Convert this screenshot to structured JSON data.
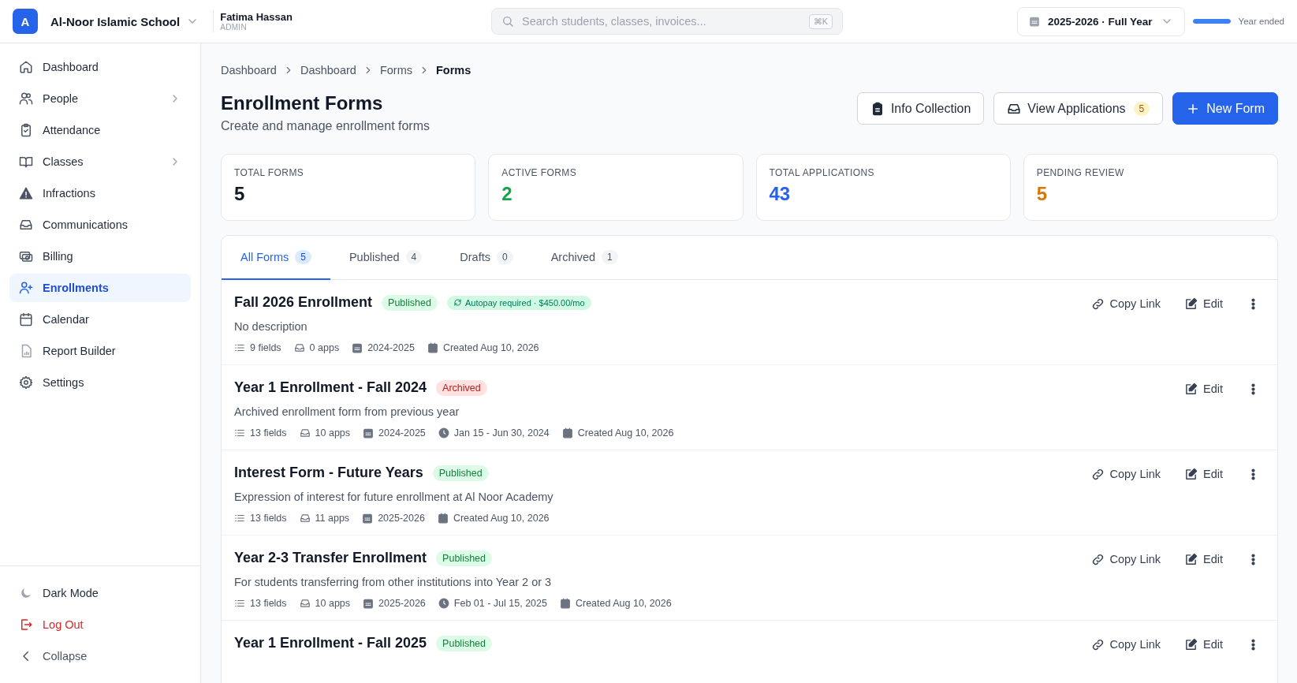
{
  "app": {
    "logo_letter": "A",
    "school": "Al-Noor Islamic School",
    "user_name": "Fatima Hassan",
    "user_role": "ADMIN"
  },
  "search": {
    "placeholder": "Search students, classes, invoices...",
    "shortcut": "⌘K"
  },
  "year_selector": {
    "label": "2025-2026 · Full Year"
  },
  "year_progress": {
    "level": 1,
    "label": "Year ended"
  },
  "sidebar": {
    "items": [
      {
        "label": "Dashboard",
        "kind": "home",
        "has_submenu": false,
        "selected": false
      },
      {
        "label": "People",
        "kind": "people",
        "has_submenu": true,
        "selected": false
      },
      {
        "label": "Attendance",
        "kind": "clipboard",
        "has_submenu": false,
        "selected": false
      },
      {
        "label": "Classes",
        "kind": "book",
        "has_submenu": true,
        "selected": false
      },
      {
        "label": "Infractions",
        "kind": "warning",
        "has_submenu": false,
        "selected": false
      },
      {
        "label": "Communications",
        "kind": "inbox",
        "has_submenu": false,
        "selected": false
      },
      {
        "label": "Billing",
        "kind": "money",
        "has_submenu": false,
        "selected": false
      },
      {
        "label": "Enrollments",
        "kind": "userplus",
        "has_submenu": false,
        "selected": true
      },
      {
        "label": "Calendar",
        "kind": "calendar",
        "has_submenu": false,
        "selected": false
      },
      {
        "label": "Report Builder",
        "kind": "report",
        "has_submenu": false,
        "selected": false
      },
      {
        "label": "Settings",
        "kind": "gear",
        "has_submenu": false,
        "selected": false
      }
    ],
    "footer": [
      {
        "label": "Dark Mode",
        "kind": "theme"
      },
      {
        "label": "Log Out",
        "kind": "logout"
      },
      {
        "label": "Collapse",
        "kind": "collapse"
      }
    ]
  },
  "breadcrumb": [
    "Dashboard",
    "Dashboard",
    "Forms",
    "Forms"
  ],
  "page": {
    "title": "Enrollment Forms",
    "subtitle": "Create and manage enrollment forms"
  },
  "actions": [
    {
      "kind": "info",
      "label": "Info Collection"
    },
    {
      "kind": "applications",
      "label": "View Applications",
      "badge": "5"
    },
    {
      "kind": "new",
      "label": "New Form"
    }
  ],
  "stats": [
    {
      "label": "TOTAL FORMS",
      "value": "5",
      "color": "#111827"
    },
    {
      "label": "ACTIVE FORMS",
      "value": "2",
      "color": "#16a34a"
    },
    {
      "label": "TOTAL APPLICATIONS",
      "value": "43",
      "color": "#2563eb"
    },
    {
      "label": "PENDING REVIEW",
      "value": "5",
      "color": "#d97706"
    }
  ],
  "tabs": [
    {
      "label": "All Forms",
      "count": "5",
      "selected": true
    },
    {
      "label": "Published",
      "count": "4",
      "selected": false
    },
    {
      "label": "Drafts",
      "count": "0",
      "selected": false
    },
    {
      "label": "Archived",
      "count": "1",
      "selected": false
    }
  ],
  "forms": [
    {
      "title": "Fall 2026 Enrollment",
      "status": {
        "kind": "published",
        "label": "Published"
      },
      "autopay": "Autopay required · $450.00/mo",
      "description": "No description",
      "meta": [
        {
          "kind": "fields",
          "text": "9 fields"
        },
        {
          "kind": "apps",
          "text": "0 apps"
        },
        {
          "kind": "year",
          "text": "2024-2025"
        },
        {
          "kind": "created",
          "text": "Created Aug 10, 2026"
        }
      ],
      "copy_link": "Copy Link",
      "edit": "Edit"
    },
    {
      "title": "Year 1 Enrollment - Fall 2024",
      "status": {
        "kind": "archived",
        "label": "Archived"
      },
      "description": "Archived enrollment form from previous year",
      "meta": [
        {
          "kind": "fields",
          "text": "13 fields"
        },
        {
          "kind": "apps",
          "text": "10 apps"
        },
        {
          "kind": "year",
          "text": "2024-2025"
        },
        {
          "kind": "window",
          "text": "Jan 15 - Jun 30, 2024"
        },
        {
          "kind": "created",
          "text": "Created Aug 10, 2026"
        }
      ],
      "edit": "Edit"
    },
    {
      "title": "Interest Form - Future Years",
      "status": {
        "kind": "published",
        "label": "Published"
      },
      "description": "Expression of interest for future enrollment at Al Noor Academy",
      "meta": [
        {
          "kind": "fields",
          "text": "13 fields"
        },
        {
          "kind": "apps",
          "text": "11 apps"
        },
        {
          "kind": "year",
          "text": "2025-2026"
        },
        {
          "kind": "created",
          "text": "Created Aug 10, 2026"
        }
      ],
      "copy_link": "Copy Link",
      "edit": "Edit"
    },
    {
      "title": "Year 2-3 Transfer Enrollment",
      "status": {
        "kind": "published",
        "label": "Published"
      },
      "description": "For students transferring from other institutions into Year 2 or 3",
      "meta": [
        {
          "kind": "fields",
          "text": "13 fields"
        },
        {
          "kind": "apps",
          "text": "10 apps"
        },
        {
          "kind": "year",
          "text": "2025-2026"
        },
        {
          "kind": "window",
          "text": "Feb 01 - Jul 15, 2025"
        },
        {
          "kind": "created",
          "text": "Created Aug 10, 2026"
        }
      ],
      "copy_link": "Copy Link",
      "edit": "Edit"
    },
    {
      "title": "Year 1 Enrollment - Fall 2025",
      "status": {
        "kind": "published",
        "label": "Published"
      },
      "copy_link": "Copy Link",
      "edit": "Edit"
    }
  ]
}
